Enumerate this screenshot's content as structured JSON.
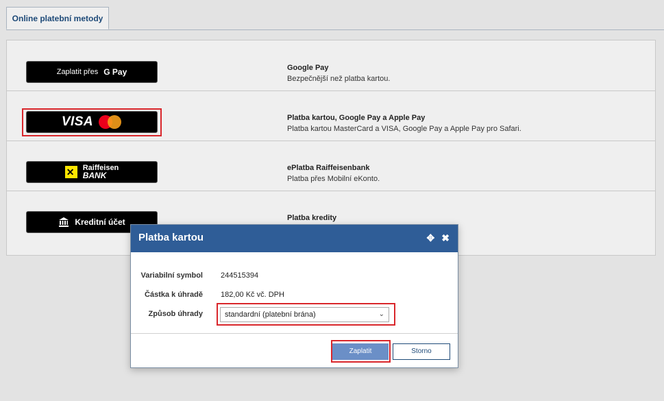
{
  "tabs": [
    {
      "label": "Online platební metody"
    }
  ],
  "methods": [
    {
      "button_text": "Zaplatit přes",
      "button_brand": "G Pay",
      "title": "Google Pay",
      "desc": "Bezpečnější než platba kartou."
    },
    {
      "button_text": "VISA",
      "title": "Platba kartou, Google Pay a Apple Pay",
      "desc": "Platba kartou MasterCard a VISA, Google Pay a Apple Pay pro Safari."
    },
    {
      "button_line1": "Raiffeisen",
      "button_line2": "BANK",
      "title": "ePlatba Raiffeisenbank",
      "desc": "Platba přes Mobilní eKonto."
    },
    {
      "button_text": "Kreditní účet",
      "title": "Platba kredity",
      "desc": ""
    }
  ],
  "dialog": {
    "title": "Platba kartou",
    "fields": [
      {
        "label": "Variabilní symbol",
        "value": "244515394"
      },
      {
        "label": "Částka k úhradě",
        "value": "182,00 Kč vč. DPH"
      },
      {
        "label": "Způsob úhrady",
        "value": "standardní (platební brána)"
      }
    ],
    "pay_label": "Zaplatit",
    "cancel_label": "Storno"
  },
  "icons": {
    "move": "move-icon",
    "close": "close-icon",
    "bank": "bank-building-icon"
  },
  "colors": {
    "header": "#2f5d97",
    "highlight": "#d9262b",
    "primary": "#6b8fc7",
    "link": "#1e4a78"
  }
}
